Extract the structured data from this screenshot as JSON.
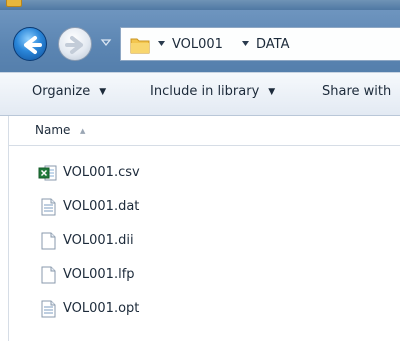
{
  "window": {
    "title_icon": "folder-icon"
  },
  "address": {
    "crumbs": [
      "VOL001",
      "DATA"
    ]
  },
  "toolbar": {
    "organize": "Organize",
    "include": "Include in library",
    "share": "Share with"
  },
  "header": {
    "name": "Name"
  },
  "files": [
    {
      "name": "VOL001.csv",
      "icon": "excel-csv-icon"
    },
    {
      "name": "VOL001.dat",
      "icon": "text-file-icon"
    },
    {
      "name": "VOL001.dii",
      "icon": "blank-file-icon"
    },
    {
      "name": "VOL001.lfp",
      "icon": "blank-file-icon"
    },
    {
      "name": "VOL001.opt",
      "icon": "text-file-icon"
    }
  ]
}
